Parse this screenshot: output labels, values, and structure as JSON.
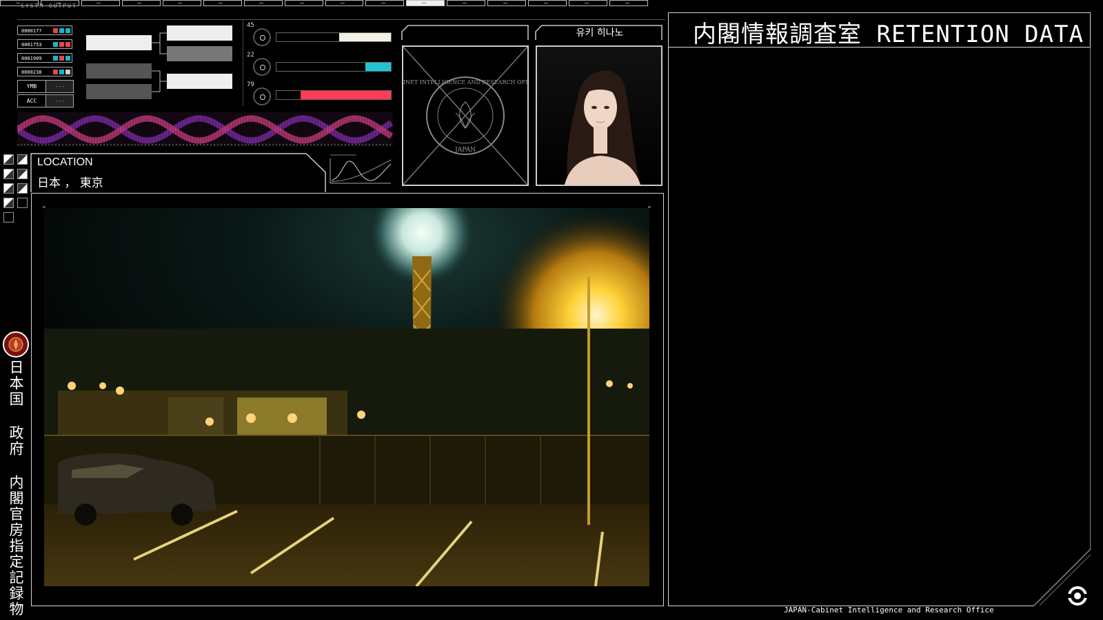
{
  "header": {
    "title": "内閣情報調査室 RETENTION DATA",
    "strip_label": "SYSTM OUTPUT"
  },
  "ids": [
    {
      "code": "0000177",
      "colors": [
        "#e8464e",
        "#19b6c8",
        "#19b6c8"
      ]
    },
    {
      "code": "0001753",
      "colors": [
        "#19b6c8",
        "#e8464e",
        "#e8464e"
      ]
    },
    {
      "code": "0001909",
      "colors": [
        "#19b6c8",
        "#e8464e",
        "#19b6c8"
      ]
    },
    {
      "code": "0000238",
      "colors": [
        "#e8464e",
        "#19b6c8",
        "#cccccc"
      ]
    }
  ],
  "kv": [
    {
      "key": "YMB",
      "value": "---"
    },
    {
      "key": "ACC",
      "value": "---"
    }
  ],
  "gauges": [
    {
      "value": "45",
      "level": 0.45,
      "color": "#f3f0e6"
    },
    {
      "value": "22",
      "level": 0.22,
      "color": "#22c3d3"
    },
    {
      "value": "79",
      "level": 0.79,
      "color": "#ff3b55"
    }
  ],
  "location": {
    "label": "LOCATION",
    "value": "日本 ， 東京"
  },
  "subject": {
    "name": "유키 히나노"
  },
  "seal": {
    "outer_text": "CABINET INTELLIGENCE AND RESEARCH OFFICE",
    "bottom_text": "JAPAN"
  },
  "left_vertical": "日本国 政府 内閣官房指定記録物",
  "footer": "JAPAN-Cabinet Intelligence and Research Office",
  "colors": {
    "accent_red": "#e8464e",
    "accent_cyan": "#19b6c8",
    "frame": "#d8d8d8"
  }
}
